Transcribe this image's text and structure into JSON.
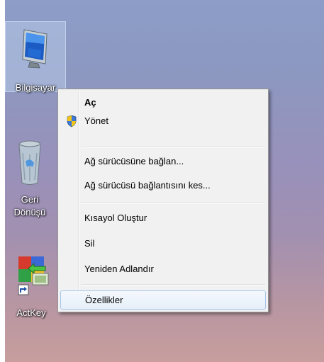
{
  "desktop": {
    "icons": [
      {
        "label": "Bilgisayar",
        "icon": "computer-icon"
      },
      {
        "label": "Geri",
        "label2": "Dönüşü",
        "icon": "recycle-bin-icon"
      },
      {
        "label": "ActKey",
        "icon": "actkey-shortcut-icon"
      }
    ]
  },
  "context_menu": {
    "items": [
      {
        "label": "Aç",
        "bold": true
      },
      {
        "label": "Yönet",
        "icon": "uac-shield-icon"
      },
      {
        "label": "Ağ sürücüsüne bağlan..."
      },
      {
        "label": "Ağ sürücüsü bağlantısını kes..."
      },
      {
        "label": "Kısayol Oluştur"
      },
      {
        "label": "Sil"
      },
      {
        "label": "Yeniden Adlandır"
      },
      {
        "label": "Özellikler",
        "highlighted": true
      }
    ]
  },
  "colors": {
    "menu_bg": "#f1f1f1",
    "highlight_border": "#a8c6ec",
    "desktop_top": "#8d9dc8",
    "desktop_bottom": "#c79e9d"
  }
}
